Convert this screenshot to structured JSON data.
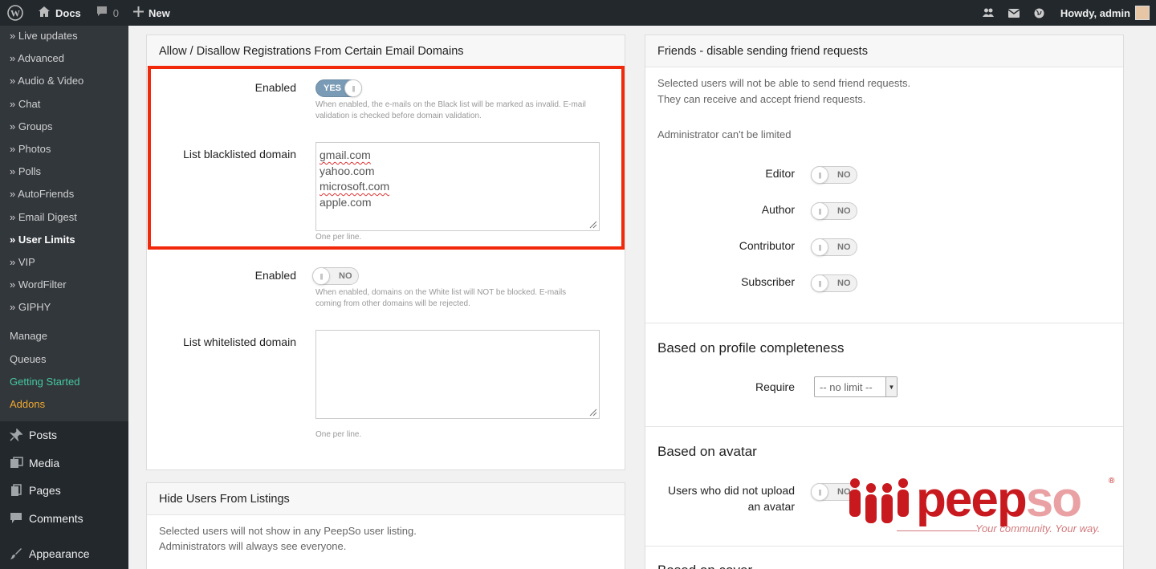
{
  "admin_bar": {
    "site_name": "Docs",
    "comments_count": "0",
    "new_label": "New",
    "howdy": "Howdy, admin",
    "icons": [
      "wordpress-logo-icon",
      "home-icon",
      "comment-icon",
      "plus-icon",
      "friends-icon",
      "mail-icon",
      "globe-icon"
    ]
  },
  "sidebar": {
    "submenu": [
      "» Live updates",
      "» Advanced",
      "» Audio & Video",
      "» Chat",
      "» Groups",
      "» Photos",
      "» Polls",
      "» AutoFriends",
      "» Email Digest",
      "» User Limits",
      "» VIP",
      "» WordFilter",
      "» GIPHY"
    ],
    "current_index": 9,
    "extras": [
      "Manage",
      "Queues",
      "Getting Started",
      "Addons"
    ],
    "menu": [
      {
        "label": "Posts",
        "icon": "pushpin-icon"
      },
      {
        "label": "Media",
        "icon": "media-icon"
      },
      {
        "label": "Pages",
        "icon": "pages-icon"
      },
      {
        "label": "Comments",
        "icon": "comments-icon"
      },
      {
        "label": "Appearance",
        "icon": "paintbrush-icon"
      }
    ]
  },
  "email_domains": {
    "title": "Allow / Disallow Registrations From Certain Email Domains",
    "blacklist": {
      "enabled_label": "Enabled",
      "toggle_text": "YES",
      "hint1": "When enabled, the e-mails on the Black list will be marked as invalid. E-mail",
      "hint2": "validation is checked before domain validation.",
      "list_label": "List blacklisted domain",
      "domains": [
        "gmail.com",
        "yahoo.com",
        "microsoft.com",
        "apple.com"
      ],
      "per_line": "One per line."
    },
    "whitelist": {
      "enabled_label": "Enabled",
      "toggle_text": "NO",
      "hint1": "When enabled, domains on the White list will NOT be blocked. E-mails",
      "hint2": "coming from other domains will be rejected.",
      "list_label": "List whitelisted domain",
      "per_line": "One per line."
    }
  },
  "hide_users": {
    "title": "Hide Users From Listings",
    "text1": "Selected users will not show in any PeepSo user listing.",
    "text2": "Administrators will always see everyone."
  },
  "friends": {
    "title": "Friends - disable sending friend requests",
    "text1": "Selected users will not be able to send friend requests.",
    "text2": "They can receive and accept friend requests.",
    "admin_note": "Administrator can't be limited",
    "roles": [
      {
        "label": "Editor",
        "toggle": "NO"
      },
      {
        "label": "Author",
        "toggle": "NO"
      },
      {
        "label": "Contributor",
        "toggle": "NO"
      },
      {
        "label": "Subscriber",
        "toggle": "NO"
      }
    ]
  },
  "profile_completeness": {
    "title": "Based on profile completeness",
    "require_label": "Require",
    "select_value": "-- no limit --"
  },
  "avatar": {
    "title": "Based on avatar",
    "label_line1": "Users who did not upload",
    "label_line2": "an avatar",
    "toggle": "NO"
  },
  "cover": {
    "title_partial": "Based on cover"
  },
  "logo": {
    "text_main": "peep",
    "text_so": "so",
    "registered": "®",
    "tagline": "Your community. Your way."
  },
  "colors": {
    "admin_dark": "#23282d",
    "sidebar_sub": "#32373c",
    "toggle_on": "#7a9bb5",
    "highlight_red": "#f2280a",
    "getting_started": "#46c8a1",
    "addons": "#f0a830",
    "peepso_red": "#c8191f"
  }
}
